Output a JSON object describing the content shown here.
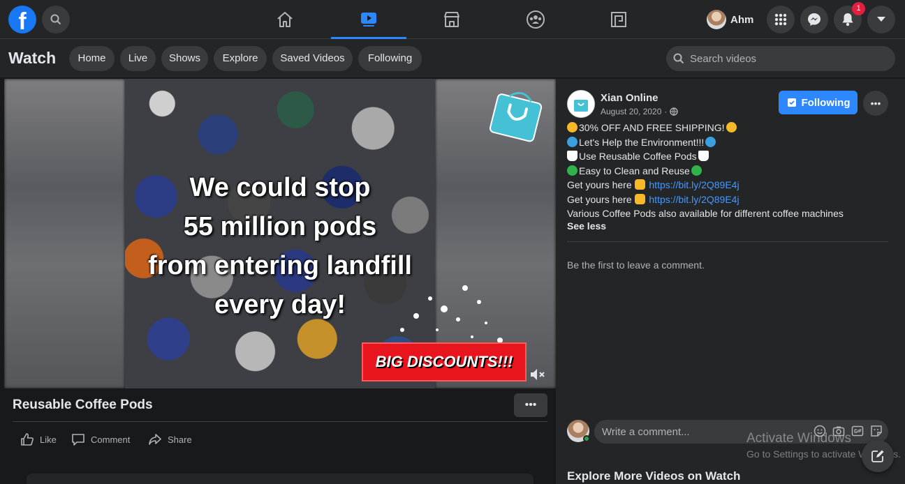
{
  "topbar": {
    "logo_letter": "f",
    "profile_name": "Ahm",
    "notification_count": "1"
  },
  "subbar": {
    "title": "Watch",
    "pills": [
      "Home",
      "Live",
      "Shows",
      "Explore",
      "Saved Videos",
      "Following"
    ],
    "search_placeholder": "Search videos"
  },
  "video": {
    "caption_lines": [
      "We could stop",
      "55 million pods",
      "from entering landfill",
      "every day!"
    ],
    "banner": "BIG DISCOUNTS!!!",
    "title": "Reusable Coffee Pods",
    "muted": true
  },
  "actions": {
    "like": "Like",
    "comment": "Comment",
    "share": "Share"
  },
  "post": {
    "page_name": "Xian Online",
    "date": "August 20, 2020",
    "follow_label": "Following",
    "lines": [
      {
        "text": "30% OFF AND FREE SHIPPING!"
      },
      {
        "text": "Let's Help the Environment!!!"
      },
      {
        "text": "Use Reusable Coffee Pods"
      },
      {
        "text": "Easy to Clean and Reuse"
      },
      {
        "prefix": "Get yours here ",
        "link": "https://bit.ly/2Q89E4j"
      },
      {
        "prefix": "Get yours here ",
        "link": "https://bit.ly/2Q89E4j"
      },
      {
        "text": "Various Coffee Pods also available for different coffee machines"
      }
    ],
    "see_less": "See less",
    "first_comment": "Be the first to leave a comment.",
    "comment_placeholder": "Write a comment...",
    "explore_more": "Explore More Videos on Watch"
  },
  "watermark": {
    "title": "Activate Windows",
    "subtitle": "Go to Settings to activate Windows."
  },
  "colors": {
    "accent": "#2d88ff",
    "background": "#18191a",
    "surface": "#242526",
    "badge": "#e41e3f"
  },
  "icons": [
    "search-icon",
    "home-icon",
    "watch-icon",
    "marketplace-icon",
    "groups-icon",
    "gaming-icon",
    "menu-grid-icon",
    "messenger-icon",
    "bell-icon",
    "caret-down-icon",
    "globe-icon",
    "bookmark-icon",
    "more-icon",
    "like-icon",
    "comment-icon",
    "share-icon",
    "mute-icon",
    "emoji-icon",
    "camera-icon",
    "gif-icon",
    "sticker-icon",
    "compose-icon"
  ]
}
